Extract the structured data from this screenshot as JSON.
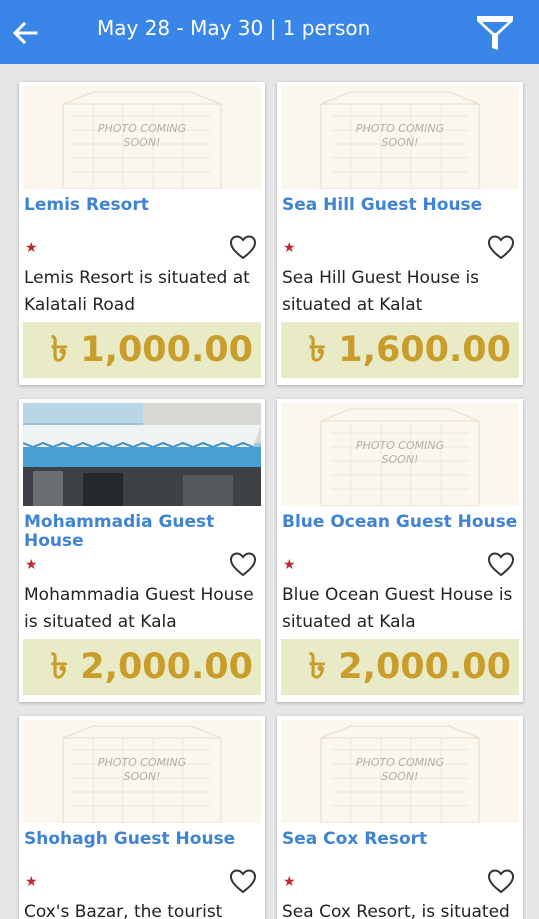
{
  "header": {
    "title": "May 28 - May 30 | 1 person",
    "back_icon": "arrow-left-icon",
    "filter_icon": "funnel-filter-icon",
    "color": "#3a86e8"
  },
  "placeholder": {
    "line1": "PHOTO COMING",
    "line2": "SOON!"
  },
  "listings": [
    {
      "name": "Lemis Resort",
      "rating": "★",
      "description": "Lemis Resort is situated at Kalatali Road",
      "price": "৳ 1,000.00",
      "photo": "placeholder"
    },
    {
      "name": "Sea Hill Guest House",
      "rating": "★",
      "description": "Sea Hill Guest House is situated at Kalat",
      "price": "৳ 1,600.00",
      "photo": "placeholder"
    },
    {
      "name": "Mohammadia Guest House",
      "rating": "★",
      "description": "Mohammadia Guest House is situated at Kala",
      "price": "৳ 2,000.00",
      "photo": "building"
    },
    {
      "name": "Blue Ocean Guest House",
      "rating": "★",
      "description": "Blue Ocean Guest House is situated at Kala",
      "price": "৳ 2,000.00",
      "photo": "placeholder"
    },
    {
      "name": "Shohagh Guest House",
      "rating": "★",
      "description": "Cox's Bazar, the tourist",
      "price": "",
      "photo": "placeholder"
    },
    {
      "name": "Sea Cox Resort",
      "rating": "★",
      "description": "Sea Cox Resort, is situated",
      "price": "",
      "photo": "placeholder"
    }
  ]
}
